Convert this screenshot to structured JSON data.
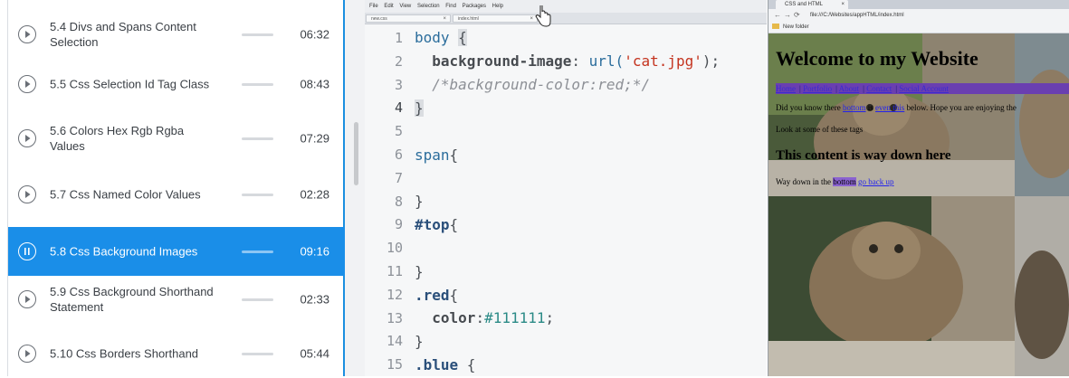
{
  "course": {
    "lessons": [
      {
        "title": "5.4 Divs and Spans Content Selection",
        "duration": "06:32",
        "active": false
      },
      {
        "title": "5.5 Css Selection Id Tag Class",
        "duration": "08:43",
        "active": false
      },
      {
        "title": "5.6 Colors Hex Rgb Rgba Values",
        "duration": "07:29",
        "active": false
      },
      {
        "title": "5.7 Css Named Color Values",
        "duration": "02:28",
        "active": false
      },
      {
        "title": "5.8 Css Background Images",
        "duration": "09:16",
        "active": true
      },
      {
        "title": "5.9 Css Background Shorthand Statement",
        "duration": "02:33",
        "active": false
      },
      {
        "title": "5.10 Css Borders Shorthand",
        "duration": "05:44",
        "active": false
      }
    ],
    "accent_color": "#1a8ee8"
  },
  "editor": {
    "menu": [
      "File",
      "Edit",
      "View",
      "Selection",
      "Find",
      "Packages",
      "Help"
    ],
    "tabs": [
      {
        "label": "new.css"
      },
      {
        "label": "index.html"
      }
    ],
    "line_numbers": [
      "1",
      "2",
      "3",
      "4",
      "5",
      "6",
      "7",
      "8",
      "9",
      "10",
      "11",
      "12",
      "13",
      "14",
      "15"
    ],
    "lines": {
      "l1_sel": "body",
      "l1_brace": "{",
      "l2_prop": "background-image",
      "l2_colon": ": ",
      "l2_fn": "url(",
      "l2_str": "'cat.jpg'",
      "l2_end": ");",
      "l3_cmt": "/*background-color:red;*/",
      "l4": "}",
      "l6_sel": "span",
      "l6_brace": "{",
      "l8": "}",
      "l9_sel": "#top",
      "l9_brace": "{",
      "l11": "}",
      "l12_sel": ".red",
      "l12_brace": "{",
      "l13_prop": "color",
      "l13_colon": ":",
      "l13_val": "#111111",
      "l13_end": ";",
      "l14": "}",
      "l15_sel": ".blue",
      "l15_brace": " {"
    }
  },
  "browser": {
    "tab_title": "CSS and HTML",
    "url": "file:///C:/Websites/appHTML/index.html",
    "bookmark": "New folder",
    "page": {
      "title": "Welcome to my Website",
      "nav": [
        "Home",
        "Portfolio",
        "About",
        "Contact",
        "Social Account"
      ],
      "p1_pre": "Did you know there ",
      "p1_link1": "bottom",
      "p1_mid": " is ",
      "p1_link2": "even this",
      "p1_post": " below. Hope you are enjoying the",
      "p2": "Look at some of these tags",
      "h2": "This content is way down here",
      "p3_pre": "Way down in the ",
      "p3_hl": "bottom",
      "p3_link": "go back up"
    }
  }
}
